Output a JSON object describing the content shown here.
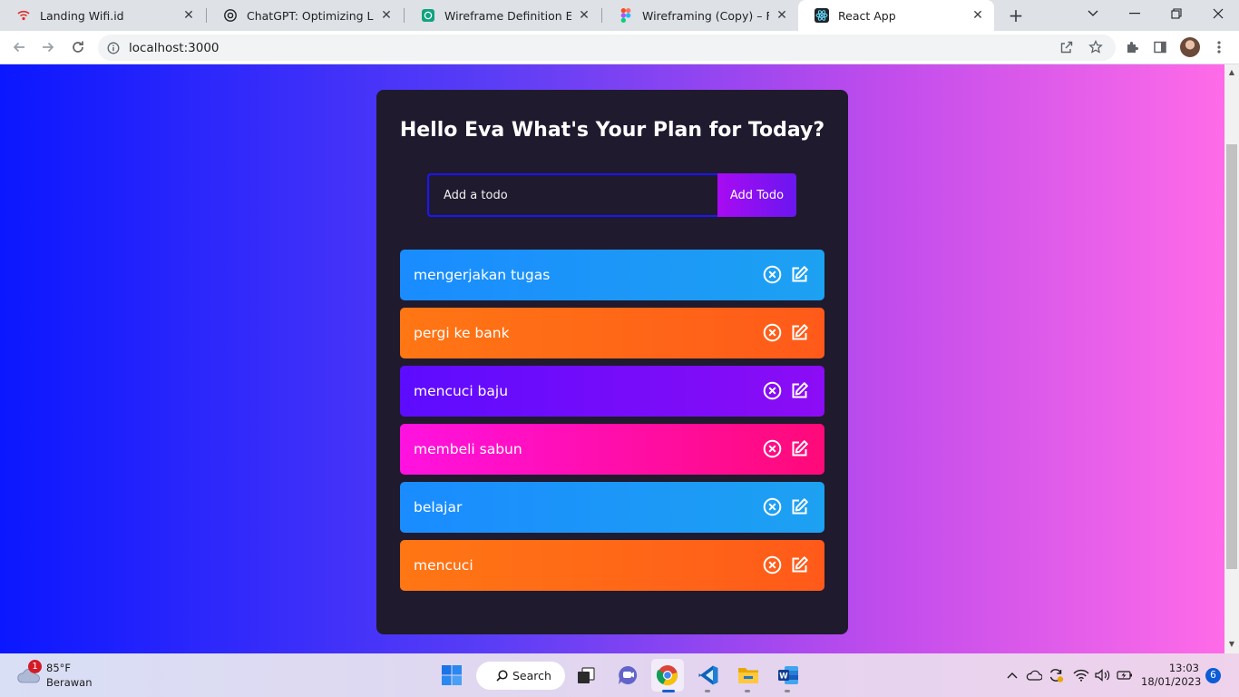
{
  "browser": {
    "tabs": [
      {
        "title": "Landing Wifi.id",
        "icon": "wifi-icon",
        "active": false
      },
      {
        "title": "ChatGPT: Optimizing Langua",
        "icon": "openai-icon",
        "active": false
      },
      {
        "title": "Wireframe Definition Explaine",
        "icon": "openai-icon",
        "active": false
      },
      {
        "title": "Wireframing (Copy) – Figma",
        "icon": "figma-icon",
        "active": false
      },
      {
        "title": "React App",
        "icon": "react-icon",
        "active": true
      }
    ],
    "url": "localhost:3000"
  },
  "app": {
    "heading": "Hello Eva What's Your Plan for Today?",
    "input_placeholder": "Add a todo",
    "add_button": "Add Todo",
    "todos": [
      {
        "text": "mengerjakan tugas",
        "color": "#1a8cff"
      },
      {
        "text": "pergi ke bank",
        "color": "#ff6a14"
      },
      {
        "text": "mencuci baju",
        "color": "#6a0cff"
      },
      {
        "text": "membeli sabun",
        "color": "#ff0aa8"
      },
      {
        "text": "belajar",
        "color": "#1a8cff"
      },
      {
        "text": "mencuci",
        "color": "#ff6a14"
      }
    ]
  },
  "taskbar": {
    "weather_badge": "1",
    "temperature": "85°F",
    "condition": "Berawan",
    "search_label": "Search",
    "time": "13:03",
    "date": "18/01/2023",
    "notification_count": "6"
  }
}
